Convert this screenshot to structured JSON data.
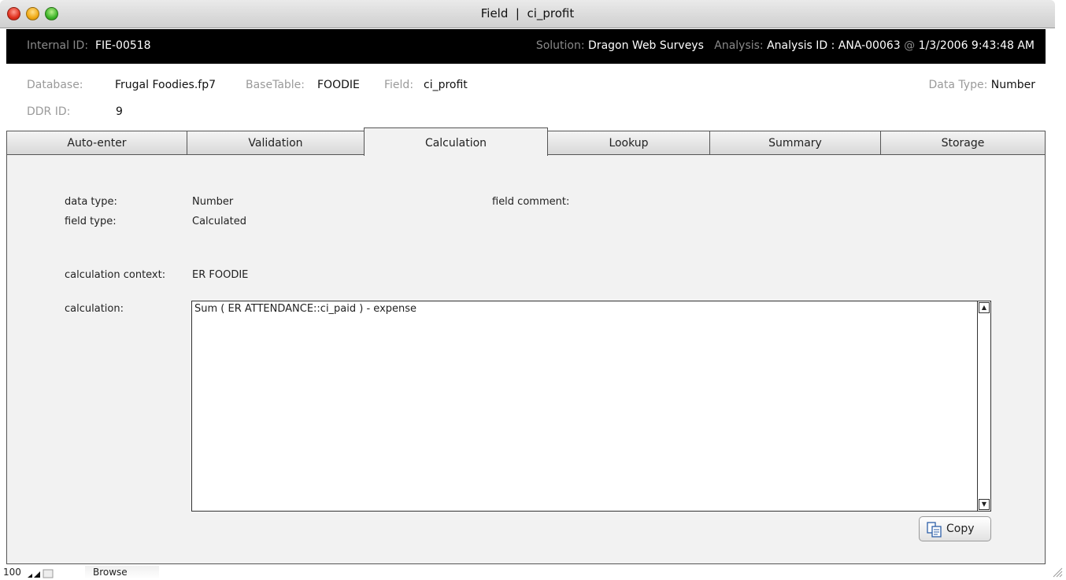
{
  "window": {
    "title": "Field  |  ci_profit"
  },
  "infobar": {
    "internal_id_label": "Internal ID:",
    "internal_id_value": "FIE-00518",
    "solution_label": "Solution:",
    "solution_value": "Dragon Web Surveys",
    "analysis_label": "Analysis:",
    "analysis_value": "Analysis ID : ANA-00063",
    "at_label": "@",
    "timestamp": "1/3/2006 9:43:48 AM"
  },
  "header": {
    "database_label": "Database:",
    "database_value": "Frugal Foodies.fp7",
    "basetable_label": "BaseTable:",
    "basetable_value": "FOODIE",
    "field_label": "Field:",
    "field_value": "ci_profit",
    "datatype_label": "Data Type:",
    "datatype_value": "Number",
    "ddr_label": "DDR ID:",
    "ddr_value": "9"
  },
  "tabs": [
    {
      "label": "Auto-enter"
    },
    {
      "label": "Validation"
    },
    {
      "label": "Calculation",
      "active": true
    },
    {
      "label": "Lookup"
    },
    {
      "label": "Summary"
    },
    {
      "label": "Storage"
    }
  ],
  "details": {
    "data_type_label": "data type:",
    "data_type_value": "Number",
    "field_type_label": "field type:",
    "field_type_value": "Calculated",
    "field_comment_label": "field comment:",
    "calc_context_label": "calculation context:",
    "calc_context_value": "ER FOODIE",
    "calculation_label": "calculation:",
    "calculation_value": "Sum ( ER ATTENDANCE::ci_paid ) - expense"
  },
  "copy_button": {
    "label": "Copy",
    "icon": "copy-icon"
  },
  "statusbar": {
    "zoom": "100",
    "mode": "Browse"
  }
}
